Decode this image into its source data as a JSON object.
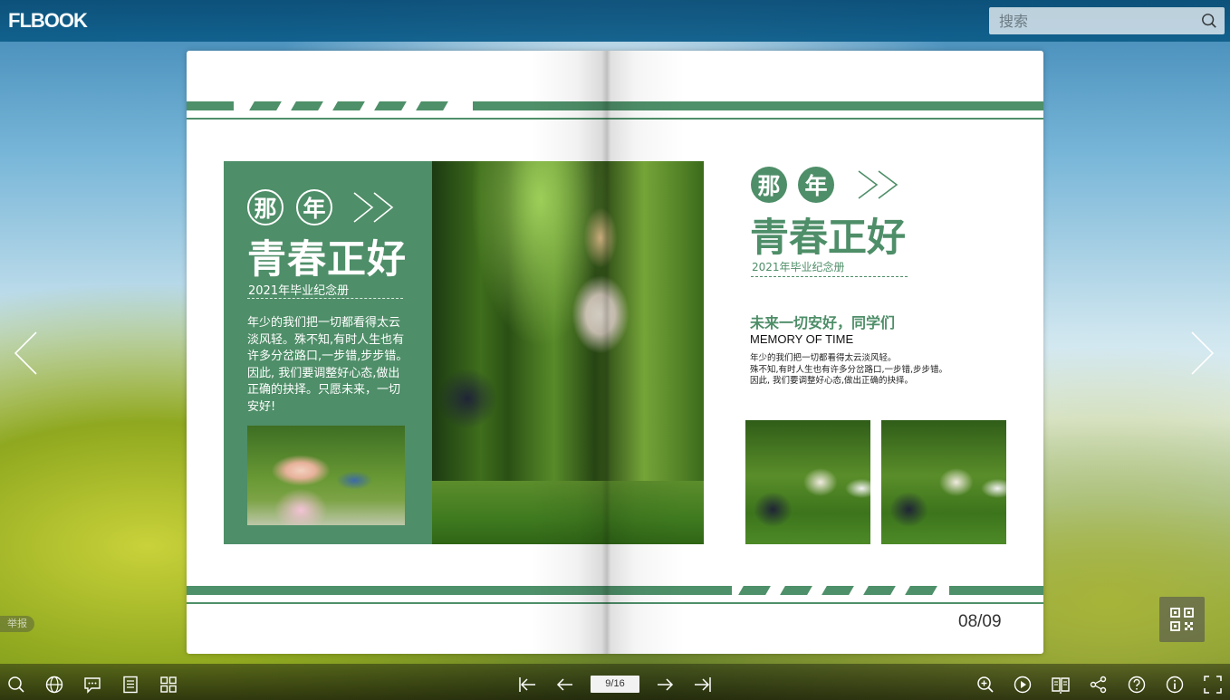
{
  "app": {
    "logo_text": "FLBOOK",
    "search_placeholder": "搜索"
  },
  "book": {
    "left_page": {
      "circle_1": "那",
      "circle_2": "年",
      "title": "青春正好",
      "subtitle": "2021年毕业纪念册",
      "paragraph": "年少的我们把一切都看得太云淡风轻。殊不知,有时人生也有许多分岔路口,一步错,步步错。因此, 我们要调整好心态,做出正确的抉择。只愿未来，一切安好!"
    },
    "right_page": {
      "circle_1": "那",
      "circle_2": "年",
      "title": "青春正好",
      "subtitle": "2021年毕业纪念册",
      "heading": "未来一切安好，同学们",
      "subheading": "MEMORY OF TIME",
      "paragraph_lines": [
        "年少的我们把一切都看得太云淡风轻。",
        "殊不知,有时人生也有许多分岔路口,一步错,步步错。",
        "因此, 我们要调整好心态,做出正确的抉择。"
      ],
      "page_number": "08/09"
    },
    "accent_color": "#4e8e68"
  },
  "report_label": "举报",
  "toolbar": {
    "page_indicator": "9/16"
  },
  "icons": {
    "left": [
      "search-icon",
      "globe-icon",
      "comment-icon",
      "table-of-contents-icon",
      "thumbnails-icon"
    ],
    "center": [
      "first-page-icon",
      "previous-page-icon",
      "next-page-icon",
      "last-page-icon"
    ],
    "right": [
      "zoom-in-icon",
      "autoplay-icon",
      "single-page-mode-icon",
      "share-icon",
      "help-icon",
      "info-icon",
      "fullscreen-icon"
    ]
  }
}
